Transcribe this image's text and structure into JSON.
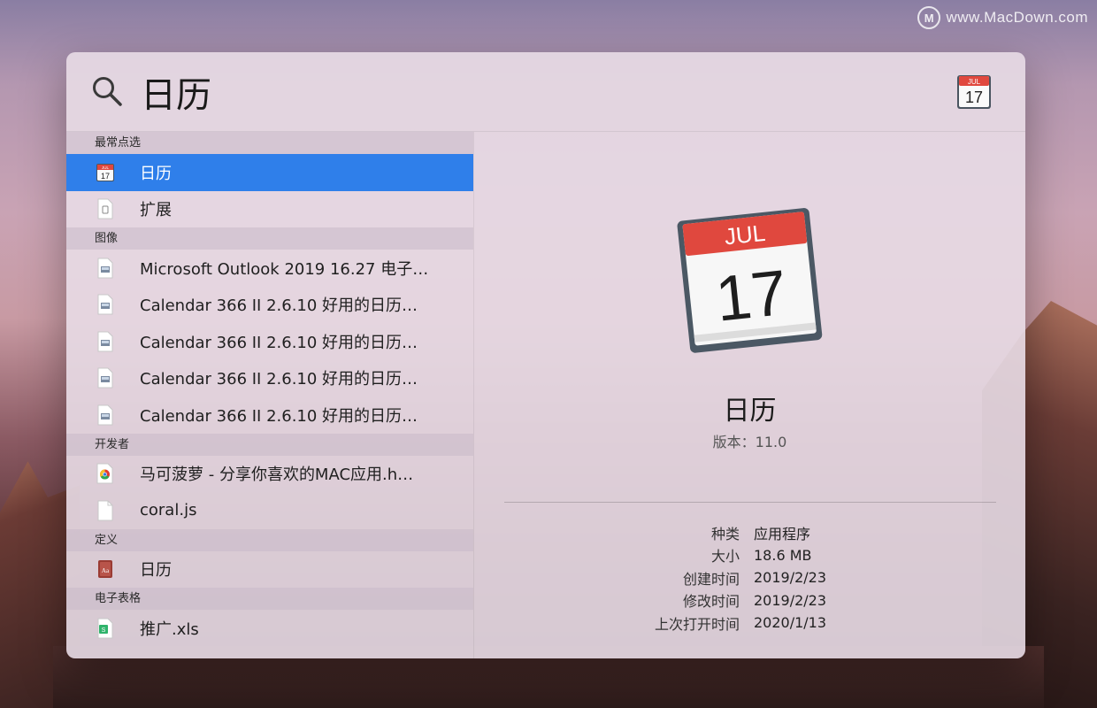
{
  "watermark": {
    "logo": "M",
    "text": "www.MacDown.com"
  },
  "search": {
    "query": "日历",
    "icon": "search-icon",
    "app_icon": "calendar-icon"
  },
  "calendar_icon": {
    "month": "JUL",
    "day": "17"
  },
  "sections": [
    {
      "title": "最常点选",
      "items": [
        {
          "label": "日历",
          "icon": "calendar-icon",
          "selected": true
        },
        {
          "label": "扩展",
          "icon": "extension-file-icon"
        }
      ]
    },
    {
      "title": "图像",
      "items": [
        {
          "label": "Microsoft Outlook 2019 16.27 电子…",
          "icon": "image-file-icon"
        },
        {
          "label": "Calendar 366 II 2.6.10 好用的日历…",
          "icon": "image-file-icon"
        },
        {
          "label": "Calendar 366 II 2.6.10 好用的日历…",
          "icon": "image-file-icon"
        },
        {
          "label": "Calendar 366 II 2.6.10 好用的日历…",
          "icon": "image-file-icon"
        },
        {
          "label": "Calendar 366 II 2.6.10 好用的日历…",
          "icon": "image-file-icon"
        }
      ]
    },
    {
      "title": "开发者",
      "items": [
        {
          "label": "马可菠萝 - 分享你喜欢的MAC应用.h…",
          "icon": "chrome-html-icon"
        },
        {
          "label": "coral.js",
          "icon": "blank-file-icon"
        }
      ]
    },
    {
      "title": "定义",
      "items": [
        {
          "label": "日历",
          "icon": "dictionary-icon"
        }
      ]
    },
    {
      "title": "电子表格",
      "items": [
        {
          "label": "推广.xls",
          "icon": "spreadsheet-icon"
        }
      ]
    }
  ],
  "preview": {
    "title": "日历",
    "version": "版本：11.0",
    "meta": [
      {
        "key": "种类",
        "value": "应用程序"
      },
      {
        "key": "大小",
        "value": "18.6 MB"
      },
      {
        "key": "创建时间",
        "value": "2019/2/23"
      },
      {
        "key": "修改时间",
        "value": "2019/2/23"
      },
      {
        "key": "上次打开时间",
        "value": "2020/1/13"
      }
    ]
  },
  "colors": {
    "selection": "#2f7fea",
    "calendar_red": "#e0483e"
  }
}
